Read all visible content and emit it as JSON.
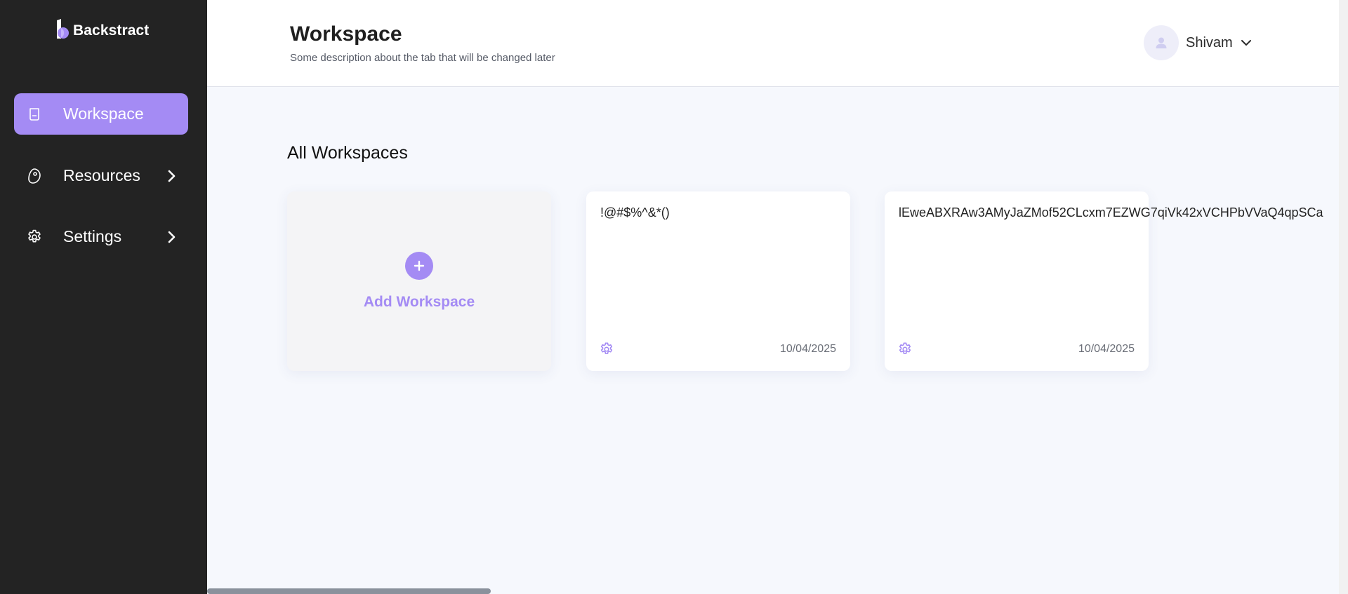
{
  "brand": {
    "name": "Backstract",
    "accent": "#a48bf4",
    "sidebar_bg": "#232323"
  },
  "sidebar": {
    "items": [
      {
        "label": "Workspace",
        "icon": "workspace-icon",
        "active": true
      },
      {
        "label": "Resources",
        "icon": "resources-tag-icon",
        "expandable": true
      },
      {
        "label": "Settings",
        "icon": "gear-icon",
        "expandable": true
      }
    ]
  },
  "header": {
    "title": "Workspace",
    "description": "Some description about the tab that will be changed later",
    "user": {
      "name": "Shivam",
      "icon": "user-avatar-icon"
    }
  },
  "main": {
    "section_title": "All Workspaces",
    "add_card": {
      "label": "Add Workspace",
      "icon": "plus-icon"
    },
    "workspaces": [
      {
        "name": "!@#$%^&*()",
        "date": "10/04/2025",
        "icon": "gear-icon"
      },
      {
        "name": "lEweABXRAw3AMyJaZMof52CLcxm7EZWG7qiVk42xVCHPbVVaQ4qpSCa",
        "date": "10/04/2025",
        "icon": "gear-icon"
      }
    ]
  }
}
